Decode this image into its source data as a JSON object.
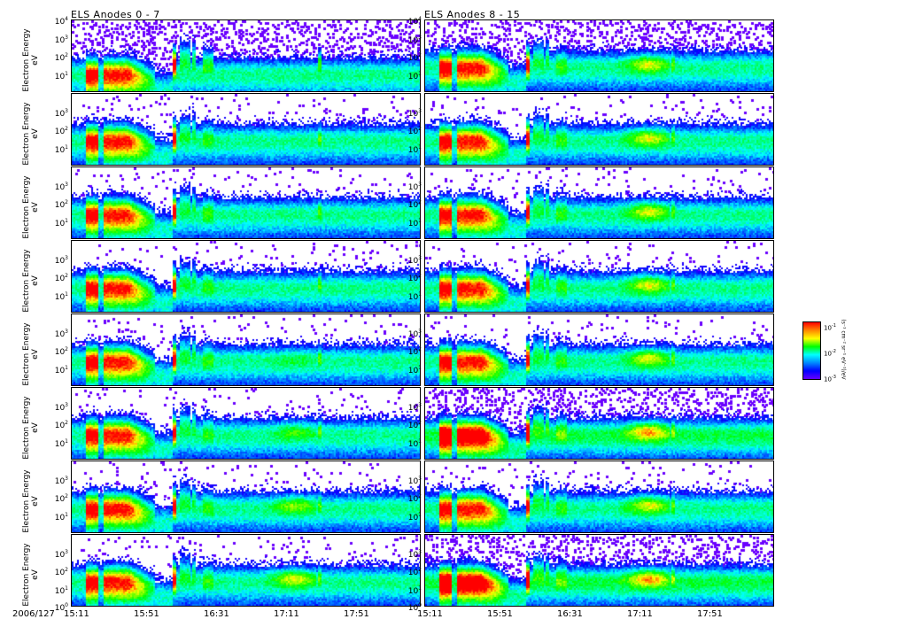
{
  "chart_data": {
    "type": "heatmap",
    "titles": [
      "ELS Anodes 0 - 7",
      "ELS Anodes 8 - 15"
    ],
    "ylabel": [
      "Electron Energy",
      "eV"
    ],
    "yscale": "log",
    "ylim": [
      1,
      10000
    ],
    "date_label": "2006/127",
    "x_ticks_left": [
      "15:11",
      "15:51",
      "16:31",
      "17:11",
      "17:51"
    ],
    "x_ticks_right": [
      "15:11",
      "15:51",
      "16:31",
      "17:11",
      "17:51"
    ],
    "xlim_minutes": [
      0,
      200
    ],
    "rows": 8,
    "columns": 2,
    "y_ticks": {
      "first": [
        {
          "b": "10",
          "e": "4"
        },
        {
          "b": "10",
          "e": "3"
        },
        {
          "b": "10",
          "e": "2"
        },
        {
          "b": "10",
          "e": "1"
        }
      ],
      "middle": [
        {
          "b": "10",
          "e": "3"
        },
        {
          "b": "10",
          "e": "2"
        },
        {
          "b": "10",
          "e": "1"
        }
      ],
      "last": [
        {
          "b": "10",
          "e": "3"
        },
        {
          "b": "10",
          "e": "2"
        },
        {
          "b": "10",
          "e": "1"
        },
        {
          "b": "10",
          "e": "0"
        }
      ]
    },
    "colorbar": {
      "colormap": "rainbow",
      "ticks": [
        {
          "b": "10",
          "e": "-1"
        },
        {
          "b": "10",
          "e": "-2"
        },
        {
          "b": "10",
          "e": "-3"
        }
      ],
      "label": "(s⁻¹ cm⁻² sr⁻¹ eV⁻¹)/eV"
    }
  }
}
